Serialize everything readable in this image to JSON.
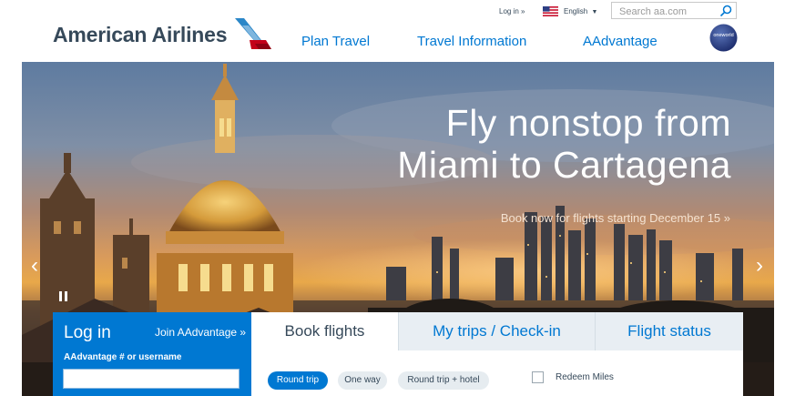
{
  "header": {
    "logo_text": "American Airlines",
    "nav": [
      "Plan Travel",
      "Travel Information",
      "AAdvantage"
    ],
    "login_link": "Log in »",
    "language": "English",
    "language_caret": "▼",
    "search_placeholder": "Search aa.com",
    "oneworld_text": "oneworld"
  },
  "hero": {
    "title_line1": "Fly nonstop from",
    "title_line2": "Miami to Cartagena",
    "subtitle": "Book now for flights starting December 15 »",
    "prev_arrow": "‹",
    "next_arrow": "›"
  },
  "login": {
    "title": "Log in",
    "join_link": "Join AAdvantage »",
    "username_label": "AAdvantage # or username",
    "username_value": ""
  },
  "booking": {
    "tabs": [
      "Book flights",
      "My trips / Check-in",
      "Flight status"
    ],
    "trip_types": [
      "Round trip",
      "One way",
      "Round trip + hotel"
    ],
    "redeem_label": "Redeem Miles"
  },
  "colors": {
    "brand_blue": "#0078D2",
    "logo_gray": "#36495A",
    "logo_red": "#C30019"
  },
  "icons": [
    "american-airlines-logo-icon",
    "us-flag-icon",
    "search-icon",
    "oneworld-icon",
    "pause-icon"
  ]
}
